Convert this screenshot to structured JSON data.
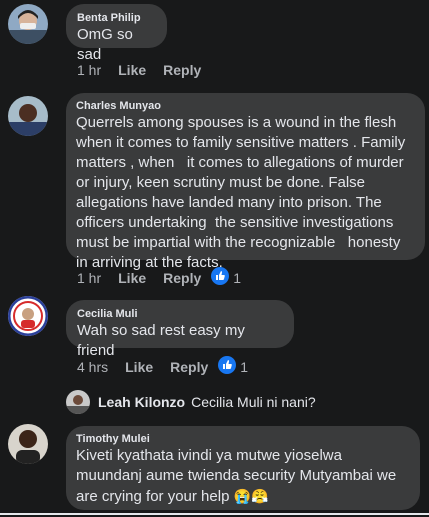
{
  "comments": [
    {
      "author": "Benta Philip",
      "text": "OmG so sad",
      "time": "1 hr",
      "like_label": "Like",
      "reply_label": "Reply"
    },
    {
      "author": "Charles Munyao",
      "text": "Querrels among spouses is a wound in the flesh when it comes to family sensitive matters . Family matters , when   it comes to allegations of murder or injury, keen scrutiny must be done. False allegations have landed many into prison. The officers undertaking  the sensitive investigations must be impartial with the recognizable   honesty in arriving at the facts.",
      "time": "1 hr",
      "like_label": "Like",
      "reply_label": "Reply",
      "reaction_count": "1"
    },
    {
      "author": "Cecilia Muli",
      "text": "Wah so sad rest easy my friend",
      "time": "4 hrs",
      "like_label": "Like",
      "reply_label": "Reply",
      "reaction_count": "1"
    },
    {
      "author": "Timothy Mulei",
      "text": "Kiveti kyathata ivindi ya mutwe yioselwa muundanj aume twienda security Mutyambai we are crying for your help",
      "emojis": "😭😤"
    }
  ],
  "reply": {
    "author": "Leah Kilonzo",
    "text": "Cecilia Muli ni nani?"
  },
  "colors": {
    "background": "#18191a",
    "bubble": "#3a3b3c",
    "text": "#e4e6eb",
    "muted": "#b0b3b8",
    "like_blue": "#1877f2"
  },
  "icons": [
    "like-reaction-icon"
  ]
}
